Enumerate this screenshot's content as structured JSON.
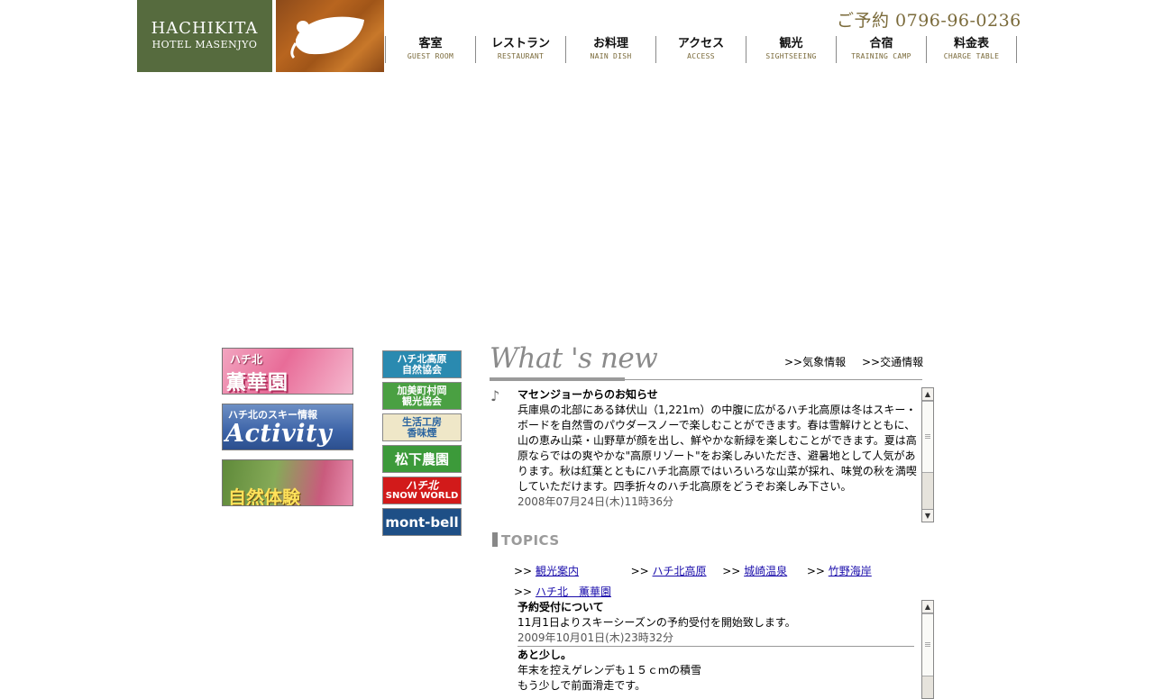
{
  "header": {
    "logo_title": "HACHIKITA",
    "logo_subtitle": "HOTEL MASENJYO",
    "phone": "ご予約 0796-96-0236"
  },
  "nav": [
    {
      "jp": "客室",
      "en": "GUEST ROOM"
    },
    {
      "jp": "レストラン",
      "en": "RESTAURANT"
    },
    {
      "jp": "お料理",
      "en": "NAIN DISH"
    },
    {
      "jp": "アクセス",
      "en": "ACCESS"
    },
    {
      "jp": "観光",
      "en": "SIGHTSEEING"
    },
    {
      "jp": "合宿",
      "en": "TRAINING CAMP"
    },
    {
      "jp": "料金表",
      "en": "CHARGE TABLE"
    }
  ],
  "banners": {
    "kunkaen": {
      "small": "ハチ北",
      "big": "薫華園"
    },
    "activity": {
      "small": "ハチ北のスキー情報",
      "big": "Activity"
    },
    "nature": {
      "big": "自然体験"
    }
  },
  "partner_links": {
    "m1": [
      "ハチ北高原",
      "自然協会"
    ],
    "m2": [
      "加美町村岡",
      "観光協会"
    ],
    "m3": [
      "生活工房",
      "香味煙"
    ],
    "m4": "松下農園",
    "m5": [
      "ハチ北",
      "SNOW WORLD"
    ],
    "m6": "mont-bell"
  },
  "whats_new": {
    "title": "What 's new",
    "links": [
      ">>気象情報",
      ">>交通情報"
    ],
    "item": {
      "heading": "マセンジョーからのお知らせ",
      "body": "兵庫県の北部にある鉢伏山（1,221ｍ）の中腹に広がるハチ北高原は冬はスキー・ボードを自然雪のパウダースノーで楽しむことができます。春は雪解けとともに、山の恵み山菜・山野草が顔を出し、鮮やかな新緑を楽しむことができます。夏は高原ならではの爽やかな\"高原リゾート\"をお楽しみいただき、避暑地として人気があります。秋は紅葉とともにハチ北高原ではいろいろな山菜が採れ、味覚の秋を満喫していただけます。四季折々のハチ北高原をどうぞお楽しみ下さい。",
      "date": "2008年07月24日(木)11時36分"
    }
  },
  "topics": {
    "title": "TOPICS",
    "prefix": ">>",
    "links": [
      "観光案内",
      "ハチ北高原",
      "城崎温泉",
      "竹野海岸",
      "ハチ北　薫華園"
    ],
    "items": [
      {
        "heading": "予約受付について",
        "body": "11月1日よりスキーシーズンの予約受付を開始致します。",
        "date": "2009年10月01日(木)23時32分"
      },
      {
        "heading": "あと少し。",
        "body": "年末を控えゲレンデも１５ｃｍの積雪",
        "body2": "もう少しで前面滑走です。"
      }
    ]
  }
}
